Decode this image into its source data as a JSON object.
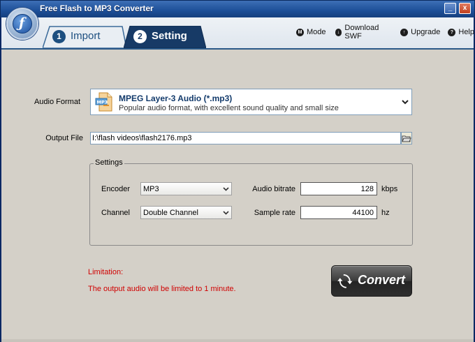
{
  "window": {
    "title": "Free Flash to MP3 Converter",
    "minimize_glyph": "_",
    "close_glyph": "x"
  },
  "tabs": [
    {
      "number": "1",
      "label": "Import",
      "active": false
    },
    {
      "number": "2",
      "label": "Setting",
      "active": true
    }
  ],
  "top_links": [
    {
      "glyph": "M",
      "label": "Mode",
      "icon": "mode-icon"
    },
    {
      "glyph": "↓",
      "label": "Download SWF",
      "icon": "download-icon"
    },
    {
      "glyph": "↑",
      "label": "Upgrade",
      "icon": "upgrade-icon"
    },
    {
      "glyph": "?",
      "label": "Help",
      "icon": "help-icon"
    }
  ],
  "audio_format": {
    "label": "Audio Format",
    "title": "MPEG Layer-3 Audio (*.mp3)",
    "description": "Popular audio format, with excellent sound quality and small size"
  },
  "output_file": {
    "label": "Output File",
    "value": "I:\\flash videos\\flash2176.mp3"
  },
  "settings": {
    "legend": "Settings",
    "encoder_label": "Encoder",
    "encoder_value": "MP3",
    "channel_label": "Channel",
    "channel_value": "Double Channel",
    "bitrate_label": "Audio bitrate",
    "bitrate_value": "128",
    "bitrate_unit": "kbps",
    "samplerate_label": "Sample rate",
    "samplerate_value": "44100",
    "samplerate_unit": "hz"
  },
  "limitation": {
    "heading": "Limitation:",
    "text": "The output audio will be limited to 1 minute."
  },
  "convert": {
    "label": "Convert"
  },
  "colors": {
    "title_bar": "#1d4f98",
    "active_tab": "#173a66",
    "content_bg": "#d4d0c8",
    "limitation_text": "#d00000"
  }
}
